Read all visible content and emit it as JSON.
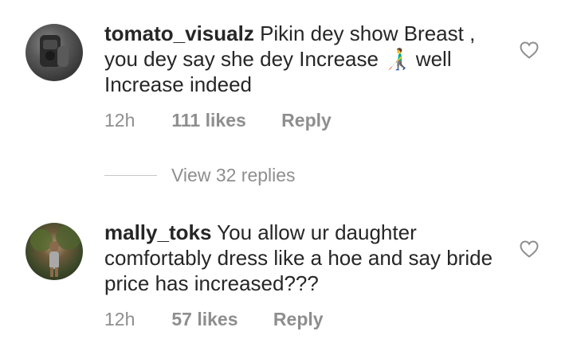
{
  "comments": [
    {
      "username": "tomato_visualz",
      "text_part1": "Pikin dey show Breast , you dey say she dey Increase ",
      "emoji": "👨‍🦯",
      "text_part2": " well Increase indeed",
      "time": "12h",
      "likes": "111 likes",
      "reply": "Reply"
    },
    {
      "username": "mally_toks",
      "text": "You allow ur daughter comfortably dress like a hoe and say bride price has increased???",
      "time": "12h",
      "likes": "57 likes",
      "reply": "Reply"
    }
  ],
  "view_replies": "View 32 replies",
  "icons": {
    "like": "heart-outline-icon"
  }
}
